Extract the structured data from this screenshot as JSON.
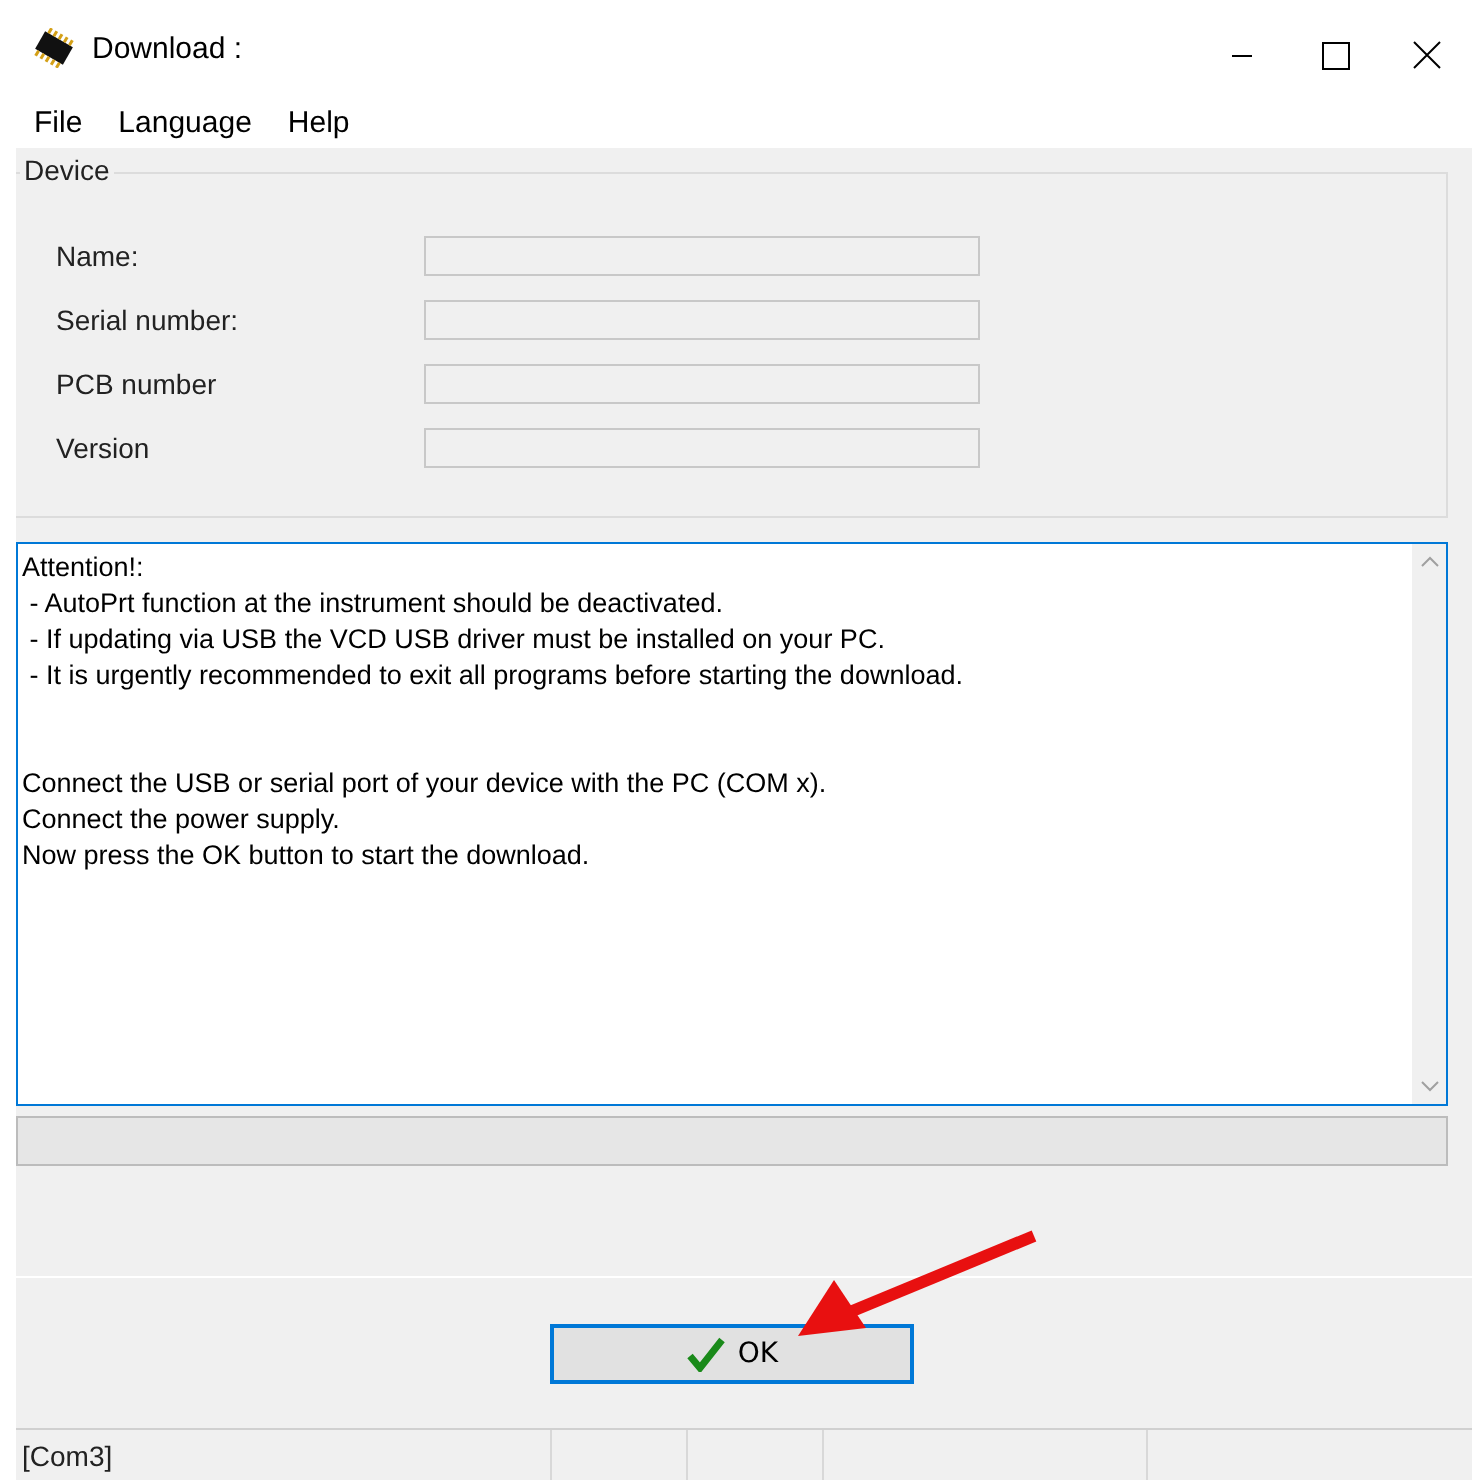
{
  "window": {
    "title": "Download :"
  },
  "menu": [
    "File",
    "Language",
    "Help"
  ],
  "device": {
    "title": "Device",
    "fields": [
      {
        "label": "Name:"
      },
      {
        "label": "Serial number:"
      },
      {
        "label": "PCB number"
      },
      {
        "label": "Version"
      }
    ]
  },
  "message": {
    "attention": [
      "Attention!:",
      " - AutoPrt function at the instrument should be deactivated.",
      " - If updating via USB the VCD USB driver must be installed on your PC.",
      " - It is urgently recommended to exit all programs before starting the download."
    ],
    "instructions": [
      "Connect the USB or serial port of your device with the PC (COM x).",
      "Connect the power supply.",
      "Now press the OK button to start the download."
    ]
  },
  "progress": {
    "level": 0
  },
  "ok_button": {
    "label": "OK"
  },
  "status_bar": {
    "port": "[Com3]"
  }
}
